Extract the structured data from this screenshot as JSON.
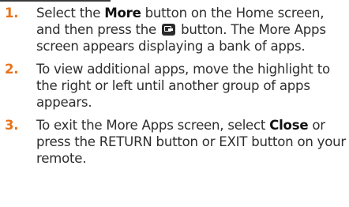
{
  "steps": [
    {
      "number": "1.",
      "part1": "Select the ",
      "bold1": "More",
      "part2": " button on the Home screen, and then press the ",
      "icon": "more-apps-button-icon",
      "part3": " button. The More Apps screen appears displaying a bank of apps."
    },
    {
      "number": "2.",
      "text": "To view additional apps, move the highlight to the right or left until another group of apps appears."
    },
    {
      "number": "3.",
      "part1": "To exit the More Apps screen, select ",
      "bold1": "Close",
      "part2": " or press the RETURN button or EXIT button on your remote."
    }
  ],
  "colors": {
    "step_number": "#e8731a",
    "text": "#2e2e2e",
    "rule": "#3a3a3a"
  }
}
